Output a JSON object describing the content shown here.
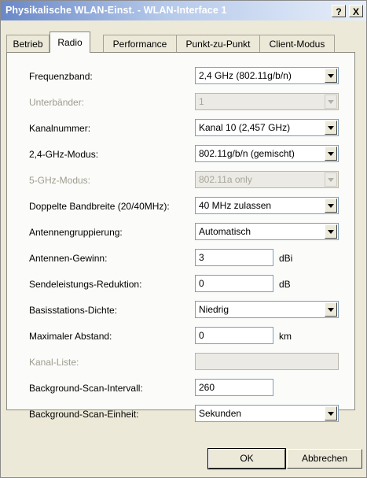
{
  "window": {
    "title": "Physikalische WLAN-Einst. - WLAN-Interface 1",
    "help_label": "?",
    "close_label": "X"
  },
  "tabs": [
    {
      "label": "Betrieb"
    },
    {
      "label": "Radio"
    },
    {
      "label": "Performance"
    },
    {
      "label": "Punkt-zu-Punkt"
    },
    {
      "label": "Client-Modus"
    }
  ],
  "active_tab": "Radio",
  "fields": {
    "frequenzband": {
      "label": "Frequenzband:",
      "value": "2,4 GHz (802.11g/b/n)"
    },
    "unterbaender": {
      "label": "Unterbänder:",
      "value": "1",
      "disabled": true
    },
    "kanalnummer": {
      "label": "Kanalnummer:",
      "value": "Kanal 10 (2,457 GHz)"
    },
    "modus24": {
      "label": "2,4-GHz-Modus:",
      "value": "802.11g/b/n (gemischt)"
    },
    "modus5": {
      "label": "5-GHz-Modus:",
      "value": "802.11a only",
      "disabled": true
    },
    "bandbreite": {
      "label": "Doppelte Bandbreite (20/40MHz):",
      "value": "40 MHz zulassen"
    },
    "antennengruppierung": {
      "label": "Antennengruppierung:",
      "value": "Automatisch"
    },
    "antennen_gewinn": {
      "label": "Antennen-Gewinn:",
      "value": "3",
      "unit": "dBi"
    },
    "sendeleistung": {
      "label": "Sendeleistungs-Reduktion:",
      "value": "0",
      "unit": "dB"
    },
    "dichte": {
      "label": "Basisstations-Dichte:",
      "value": "Niedrig"
    },
    "abstand": {
      "label": "Maximaler Abstand:",
      "value": "0",
      "unit": "km"
    },
    "kanal_liste": {
      "label": "Kanal-Liste:",
      "value": "",
      "disabled": true
    },
    "scan_intervall": {
      "label": "Background-Scan-Intervall:",
      "value": "260"
    },
    "scan_einheit": {
      "label": "Background-Scan-Einheit:",
      "value": "Sekunden"
    }
  },
  "buttons": {
    "ok": "OK",
    "cancel": "Abbrechen"
  }
}
